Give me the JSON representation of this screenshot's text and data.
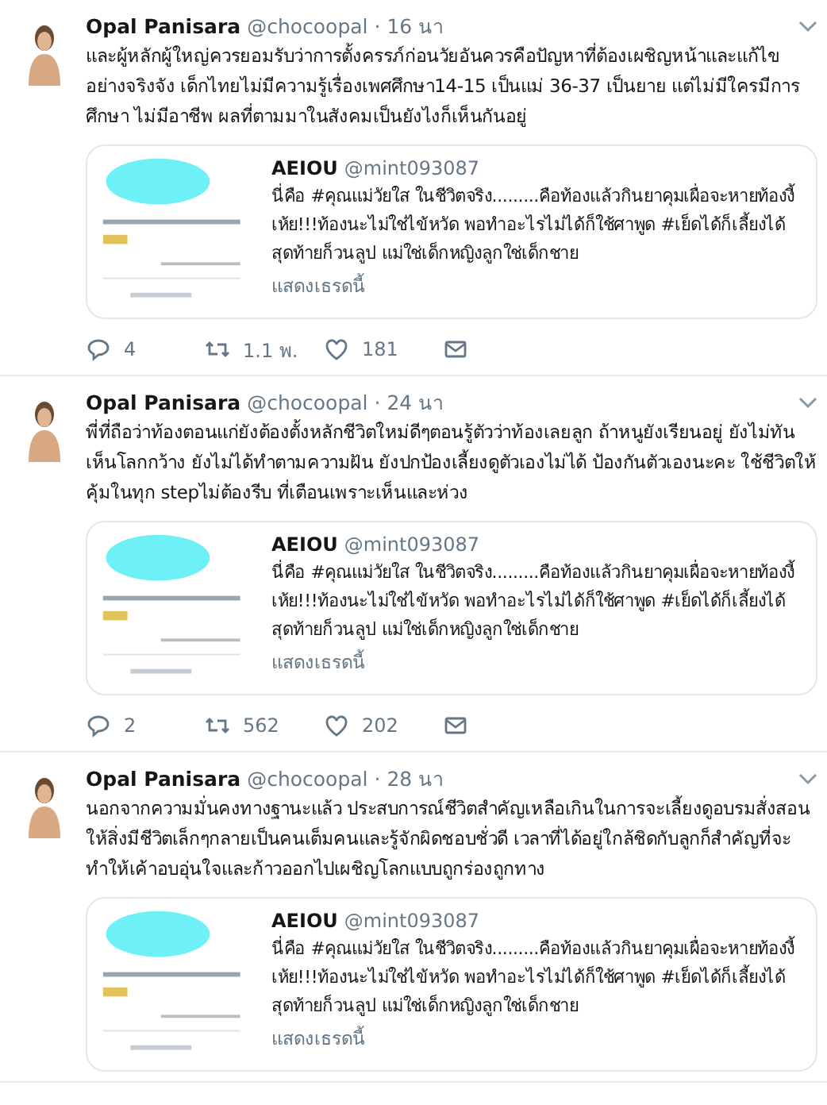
{
  "tweets": [
    {
      "name": "Opal Panisara",
      "handle": "@chocoopal",
      "time": "· 16 นา",
      "text": "และผู้หลักผู้ใหญ่ควรยอมรับว่าการตั้งครรภ์ก่อนวัยอันควรคือปัญหาที่ต้องเผชิญหน้าและแก้ไขอย่างจริงจัง เด็กไทยไม่มีความรู้เรื่องเพศศึกษา14-15 เป็นแม่ 36-37 เป็นยาย แต่ไม่มีใครมีการศึกษา ไม่มีอาชีพ ผลที่ตามมาในสังคมเป็นยังไงก็เห็นกันอยู่",
      "quote": {
        "name": "AEIOU",
        "handle": "@mint093087",
        "text": "นี่คือ #คุณแม่วัยใส ในชีวิตจริง.........คือท้องแล้วกินยาคุมเผื่อจะหายท้องงี้ เห้ย!!!ท้องนะไม่ใช่ไข้หวัด พอทำอะไรไม่ได้ก็ใช้ศาพูด #เย็ดได้ก็เลี้ยงได้ สุดท้ายก็วนลูป แม่ใช่เด็กหญิงลูกใช่เด็กชาย",
        "thread": "แสดงเธรดนี้"
      },
      "actions": {
        "replies": "4",
        "retweets": "1.1 พ.",
        "likes": "181"
      }
    },
    {
      "name": "Opal Panisara",
      "handle": "@chocoopal",
      "time": "· 24 นา",
      "text": "พี่ที่ถือว่าท้องตอนแก่ยังต้องตั้งหลักชีวิตใหม่ดีๆตอนรู้ตัวว่าท้องเลยลูก ถ้าหนูยังเรียนอยู่ ยังไม่ทันเห็นโลกกว้าง ยังไม่ได้ทำตามความฝัน ยังปกป้องเลี้ยงดูตัวเองไม่ได้ ป้องกันตัวเองนะคะ ใช้ชีวิตให้คุ้มในทุก stepไม่ต้องรีบ ที่เตือนเพราะเห็นและห่วง",
      "quote": {
        "name": "AEIOU",
        "handle": "@mint093087",
        "text": "นี่คือ #คุณแม่วัยใส ในชีวิตจริง.........คือท้องแล้วกินยาคุมเผื่อจะหายท้องงี้ เห้ย!!!ท้องนะไม่ใช่ไข้หวัด พอทำอะไรไม่ได้ก็ใช้ศาพูด #เย็ดได้ก็เลี้ยงได้ สุดท้ายก็วนลูป แม่ใช่เด็กหญิงลูกใช่เด็กชาย",
        "thread": "แสดงเธรดนี้"
      },
      "actions": {
        "replies": "2",
        "retweets": "562",
        "likes": "202"
      }
    },
    {
      "name": "Opal Panisara",
      "handle": "@chocoopal",
      "time": "· 28 นา",
      "text": "นอกจากความมั่นคงทางฐานะแล้ว ประสบการณ์ชีวิตสำคัญเหลือเกินในการจะเลี้ยงดูอบรมสั่งสอนให้สิ่งมีชีวิตเล็กๆกลายเป็นคนเต็มคนและรู้จักผิดชอบชั่วดี เวลาที่ได้อยู่ใกล้ชิดกับลูกก็สำคัญที่จะทำให้เค้าอบอุ่นใจและก้าวออกไปเผชิญโลกแบบถูกร่องถูกทาง",
      "quote": {
        "name": "AEIOU",
        "handle": "@mint093087",
        "text": "นี่คือ #คุณแม่วัยใส ในชีวิตจริง.........คือท้องแล้วกินยาคุมเผื่อจะหายท้องงี้ เห้ย!!!ท้องนะไม่ใช่ไข้หวัด พอทำอะไรไม่ได้ก็ใช้ศาพูด #เย็ดได้ก็เลี้ยงได้ สุดท้ายก็วนลูป แม่ใช่เด็กหญิงลูกใช่เด็กชาย",
        "thread": "แสดงเธรดนี้"
      }
    }
  ]
}
